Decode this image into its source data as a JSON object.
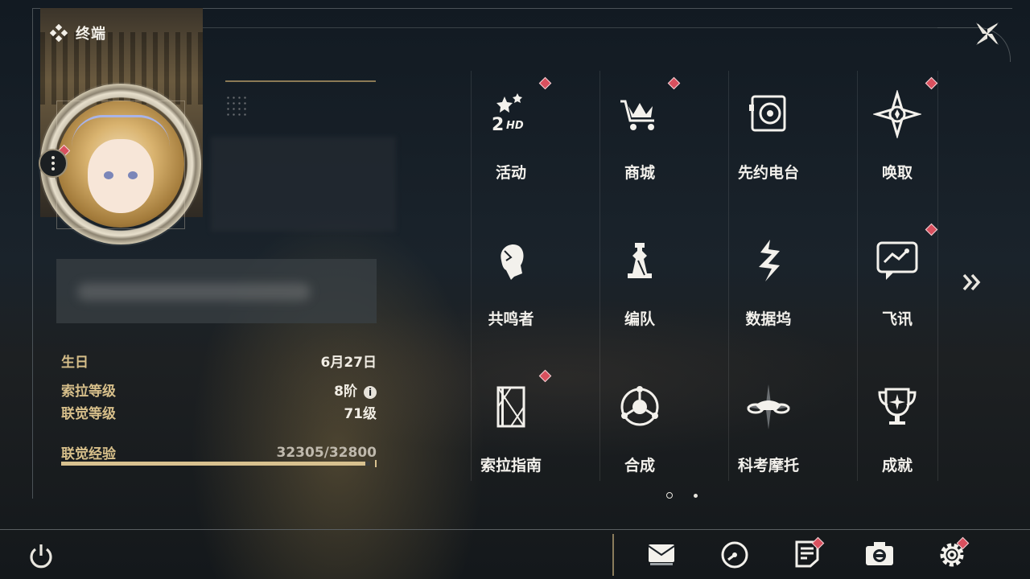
{
  "header": {
    "title": "终端"
  },
  "profile": {
    "birthday_label": "生日",
    "birthday": "6月27日",
    "rank_label": "索拉等级",
    "rank": "8阶",
    "level_label": "联觉等级",
    "level": "71级",
    "exp_label": "联觉经验",
    "exp": "32305/32800",
    "exp_fraction": 0.985
  },
  "menu": [
    {
      "label": "活动",
      "icon": "event-2hd-icon",
      "badge": true
    },
    {
      "label": "商城",
      "icon": "shop-crown-cart-icon",
      "badge": true
    },
    {
      "label": "先约电台",
      "icon": "radio-speaker-icon",
      "badge": false
    },
    {
      "label": "唤取",
      "icon": "compass-star-icon",
      "badge": true
    },
    {
      "label": "共鸣者",
      "icon": "resonator-head-icon",
      "badge": false
    },
    {
      "label": "编队",
      "icon": "team-chess-icon",
      "badge": false
    },
    {
      "label": "数据坞",
      "icon": "data-dock-icon",
      "badge": false
    },
    {
      "label": "飞讯",
      "icon": "message-bubble-icon",
      "badge": true
    },
    {
      "label": "索拉指南",
      "icon": "guide-book-icon",
      "badge": true
    },
    {
      "label": "合成",
      "icon": "synthesis-icon",
      "badge": false
    },
    {
      "label": "科考摩托",
      "icon": "motorbike-icon",
      "badge": false
    },
    {
      "label": "成就",
      "icon": "trophy-icon",
      "badge": false
    }
  ],
  "pagination": {
    "current": 1,
    "total": 2
  },
  "bottom_bar": {
    "icons": [
      {
        "name": "mail-icon",
        "badge": false
      },
      {
        "name": "clock-icon",
        "badge": false
      },
      {
        "name": "notice-icon",
        "badge": true
      },
      {
        "name": "camera-icon",
        "badge": false
      },
      {
        "name": "settings-gear-icon",
        "badge": true
      }
    ]
  },
  "colors": {
    "accent_gold": "#d7bf8a",
    "badge_red": "#d9505e"
  }
}
